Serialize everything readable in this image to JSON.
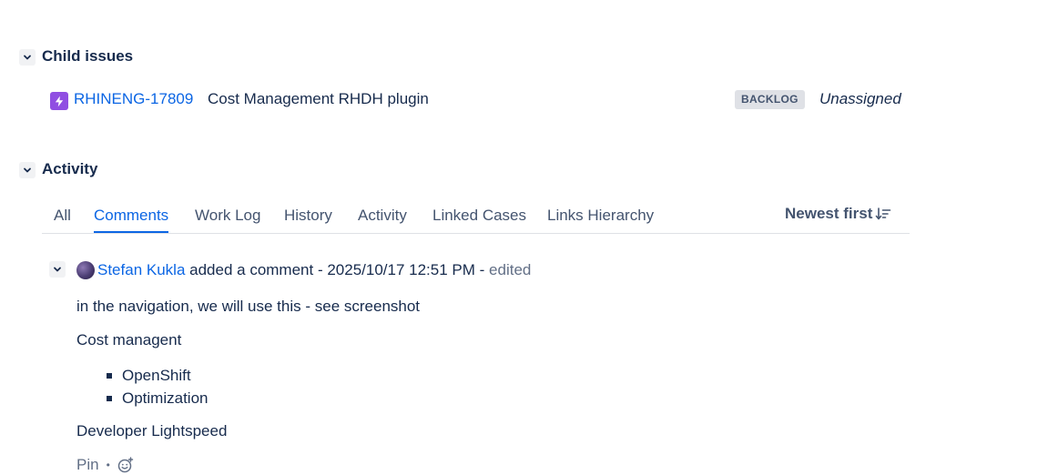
{
  "child_issues": {
    "title": "Child issues",
    "issues": [
      {
        "icon": "story-icon",
        "key": "RHINENG-17809",
        "summary": "Cost Management RHDH plugin",
        "status": "BACKLOG",
        "assignee": "Unassigned"
      }
    ]
  },
  "activity": {
    "title": "Activity",
    "tabs": [
      {
        "label": "All",
        "active": false
      },
      {
        "label": "Comments",
        "active": true
      },
      {
        "label": "Work Log",
        "active": false
      },
      {
        "label": "History",
        "active": false
      },
      {
        "label": "Activity",
        "active": false
      },
      {
        "label": "Linked Cases",
        "active": false
      },
      {
        "label": "Links Hierarchy",
        "active": false
      }
    ],
    "sort_label": "Newest first"
  },
  "comment": {
    "author": "Stefan Kukla",
    "action": "added a comment",
    "separator": " - ",
    "timestamp": "2025/10/17 12:51 PM",
    "edited": "edited",
    "paragraphs": [
      "in the navigation, we will use this - see screenshot",
      "Cost managent",
      "Developer Lightspeed"
    ],
    "bullets": [
      "OpenShift",
      "Optimization"
    ],
    "footer": {
      "pin": "Pin",
      "dot": "•",
      "reaction_icon": "add-reaction-icon"
    }
  },
  "colors": {
    "link": "#0c66e4",
    "text": "#172b4d",
    "subtle": "#44546f",
    "story": "#904ee2",
    "lozenge_bg": "#dfe1e6"
  }
}
